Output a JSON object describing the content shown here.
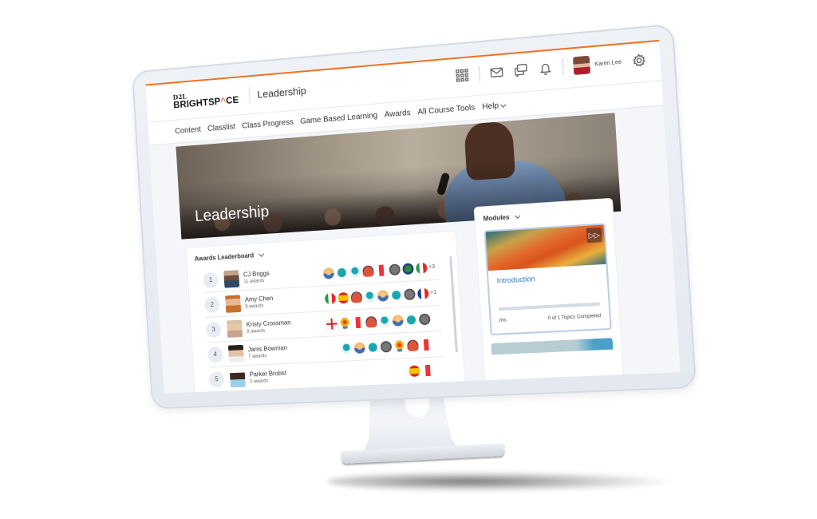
{
  "header": {
    "logo_top": "D2L",
    "logo_main_pre": "BRIGHTSP",
    "logo_caret": "^",
    "logo_main_post": "CE",
    "course_title": "Leadership",
    "user_name": "Karen Lee",
    "icons": [
      "apps-grid-icon",
      "mail-icon",
      "chat-icon",
      "bell-icon",
      "gear-icon"
    ]
  },
  "nav": {
    "items": [
      "Content",
      "Classlist",
      "Class Progress",
      "Game Based Learning",
      "Awards",
      "All Course Tools"
    ],
    "help_label": "Help"
  },
  "banner": {
    "title": "Leadership"
  },
  "leaderboard": {
    "title": "Awards Leaderboard",
    "rows": [
      {
        "rank": "1",
        "name": "CJ Briggs",
        "awards": "11 awards",
        "badges": [
          "people",
          "trophy",
          "medal",
          "helmet",
          "ext",
          "pencil",
          "globe",
          "it"
        ],
        "more": "+3"
      },
      {
        "rank": "2",
        "name": "Amy Chen",
        "awards": "9 awards",
        "badges": [
          "it",
          "es",
          "helmet",
          "medal",
          "people",
          "trophy",
          "pencil",
          "fr"
        ],
        "more": "+1"
      },
      {
        "rank": "3",
        "name": "Kristy Crossman",
        "awards": "8 awards",
        "badges": [
          "en",
          "ribbon",
          "ext",
          "helmet",
          "medal",
          "people",
          "trophy",
          "pencil"
        ],
        "more": ""
      },
      {
        "rank": "4",
        "name": "Janis Bowman",
        "awards": "7 awards",
        "badges": [
          "medal",
          "people",
          "trophy",
          "pencil",
          "ribbon",
          "helmet",
          "ext"
        ],
        "more": ""
      },
      {
        "rank": "5",
        "name": "Parker Brobst",
        "awards": "2 awards",
        "badges": [
          "es",
          "ext"
        ],
        "more": ""
      }
    ]
  },
  "modules": {
    "title": "Modules",
    "card": {
      "title": "Introduction",
      "progress_percent": 0,
      "progress_label": "0%",
      "topics_label": "0 of 1 Topics Completed"
    }
  },
  "colors": {
    "accent": "#f36f21",
    "link": "#2a7bc4"
  }
}
